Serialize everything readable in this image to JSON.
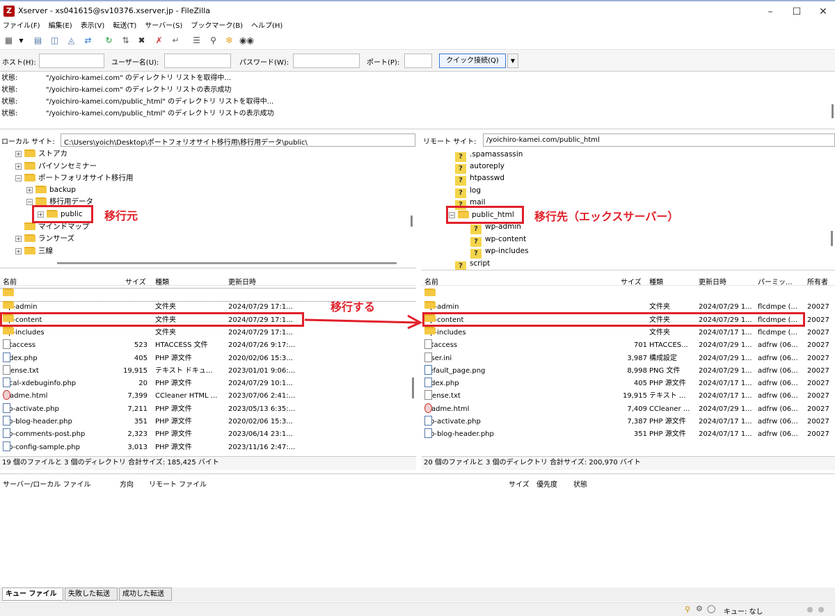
{
  "window": {
    "title": "Xserver - xs041615@sv10376.xserver.jp - FileZilla",
    "app_letter": "Z"
  },
  "menu": [
    "ファイル(F)",
    "編集(E)",
    "表示(V)",
    "転送(T)",
    "サーバー(S)",
    "ブックマーク(B)",
    "ヘルプ(H)"
  ],
  "connect": {
    "host_label": "ホスト(H):",
    "user_label": "ユーザー名(U):",
    "pass_label": "パスワード(W):",
    "port_label": "ポート(P):",
    "quick_label": "クイック接続(Q)"
  },
  "log": [
    {
      "k": "状態:",
      "v": "\"/yoichiro-kamei.com\" のディレクトリ リストを取得中..."
    },
    {
      "k": "状態:",
      "v": "\"/yoichiro-kamei.com\" のディレクトリ リストの表示成功"
    },
    {
      "k": "状態:",
      "v": "\"/yoichiro-kamei.com/public_html\" のディレクトリ リストを取得中..."
    },
    {
      "k": "状態:",
      "v": "\"/yoichiro-kamei.com/public_html\" のディレクトリ リストの表示成功"
    }
  ],
  "local": {
    "site_label": "ローカル サイト:",
    "path": "C:\\Users\\yoich\\Desktop\\ポートフォリオサイト移行用\\移行用データ\\public\\",
    "tree": [
      "ストアカ",
      "パイソンセミナー",
      "ポートフォリオサイト移行用",
      "backup",
      "移行用データ",
      "public",
      "マインドマップ",
      "ランサーズ",
      "三線"
    ],
    "headers": {
      "name": "名前",
      "size": "サイズ",
      "type": "種類",
      "date": "更新日時"
    },
    "files": [
      {
        "n": "..",
        "s": "",
        "t": "",
        "d": ""
      },
      {
        "n": "wp-admin",
        "s": "",
        "t": "文件夹",
        "d": "2024/07/29 17:1..."
      },
      {
        "n": "wp-content",
        "s": "",
        "t": "文件夹",
        "d": "2024/07/29 17:1..."
      },
      {
        "n": "wp-includes",
        "s": "",
        "t": "文件夹",
        "d": "2024/07/29 17:1..."
      },
      {
        "n": ".htaccess",
        "s": "523",
        "t": "HTACCESS 文件",
        "d": "2024/07/26 9:17:..."
      },
      {
        "n": "index.php",
        "s": "405",
        "t": "PHP 源文件",
        "d": "2020/02/06 15:3..."
      },
      {
        "n": "license.txt",
        "s": "19,915",
        "t": "テキスト ドキュ...",
        "d": "2023/01/01 9:06:..."
      },
      {
        "n": "local-xdebuginfo.php",
        "s": "20",
        "t": "PHP 源文件",
        "d": "2024/07/29 10:1..."
      },
      {
        "n": "readme.html",
        "s": "7,399",
        "t": "CCleaner HTML ...",
        "d": "2023/07/06 2:41:..."
      },
      {
        "n": "wp-activate.php",
        "s": "7,211",
        "t": "PHP 源文件",
        "d": "2023/05/13 6:35:..."
      },
      {
        "n": "wp-blog-header.php",
        "s": "351",
        "t": "PHP 源文件",
        "d": "2020/02/06 15:3..."
      },
      {
        "n": "wp-comments-post.php",
        "s": "2,323",
        "t": "PHP 源文件",
        "d": "2023/06/14 23:1..."
      },
      {
        "n": "wp-config-sample.php",
        "s": "3,013",
        "t": "PHP 源文件",
        "d": "2023/11/16 2:47:..."
      }
    ],
    "status": "19 個のファイルと 3 個のディレクトリ 合計サイズ: 185,425 バイト"
  },
  "remote": {
    "site_label": "リモート サイト:",
    "path": "/yoichiro-kamei.com/public_html",
    "tree": [
      ".spamassassin",
      "autoreply",
      "htpasswd",
      "log",
      "mail",
      "public_html",
      "wp-admin",
      "wp-content",
      "wp-includes",
      "script"
    ],
    "headers": {
      "name": "名前",
      "size": "サイズ",
      "type": "種類",
      "date": "更新日時",
      "perm": "パーミッ...",
      "owner": "所有者"
    },
    "files": [
      {
        "n": "..",
        "s": "",
        "t": "",
        "d": "",
        "p": "",
        "o": ""
      },
      {
        "n": "wp-admin",
        "s": "",
        "t": "文件夹",
        "d": "2024/07/29 1...",
        "p": "flcdmpe (...",
        "o": "20027"
      },
      {
        "n": "wp-content",
        "s": "",
        "t": "文件夹",
        "d": "2024/07/29 1...",
        "p": "flcdmpe (...",
        "o": "20027"
      },
      {
        "n": "wp-includes",
        "s": "",
        "t": "文件夹",
        "d": "2024/07/17 1...",
        "p": "flcdmpe (...",
        "o": "20027"
      },
      {
        "n": ".htaccess",
        "s": "701",
        "t": "HTACCES...",
        "d": "2024/07/29 1...",
        "p": "adfrw (06...",
        "o": "20027"
      },
      {
        "n": ".user.ini",
        "s": "3,987",
        "t": "構成設定",
        "d": "2024/07/29 1...",
        "p": "adfrw (06...",
        "o": "20027"
      },
      {
        "n": "default_page.png",
        "s": "8,998",
        "t": "PNG 文件",
        "d": "2024/07/29 1...",
        "p": "adfrw (06...",
        "o": "20027"
      },
      {
        "n": "index.php",
        "s": "405",
        "t": "PHP 源文件",
        "d": "2024/07/17 1...",
        "p": "adfrw (06...",
        "o": "20027"
      },
      {
        "n": "license.txt",
        "s": "19,915",
        "t": "テキスト ...",
        "d": "2024/07/17 1...",
        "p": "adfrw (06...",
        "o": "20027"
      },
      {
        "n": "readme.html",
        "s": "7,409",
        "t": "CCleaner ...",
        "d": "2024/07/29 1...",
        "p": "adfrw (06...",
        "o": "20027"
      },
      {
        "n": "wp-activate.php",
        "s": "7,387",
        "t": "PHP 源文件",
        "d": "2024/07/17 1...",
        "p": "adfrw (06...",
        "o": "20027"
      },
      {
        "n": "wp-blog-header.php",
        "s": "351",
        "t": "PHP 源文件",
        "d": "2024/07/17 1...",
        "p": "adfrw (06...",
        "o": "20027"
      }
    ],
    "status": "20 個のファイルと 3 個のディレクトリ 合計サイズ: 200,970 バイト"
  },
  "queue": {
    "headers": {
      "server_local": "サーバー/ローカル ファイル",
      "direction": "方向",
      "remote": "リモート ファイル",
      "size": "サイズ",
      "priority": "優先度",
      "status": "状態"
    },
    "tabs": [
      "キュー ファイル",
      "失敗した転送",
      "成功した転送"
    ],
    "queue_status": "キュー: なし"
  },
  "annotations": {
    "source": "移行元",
    "target": "移行先（エックスサーバー）",
    "move": "移行する"
  },
  "colors": {
    "annotation": "#e0202a",
    "folder": "#f5c842"
  }
}
